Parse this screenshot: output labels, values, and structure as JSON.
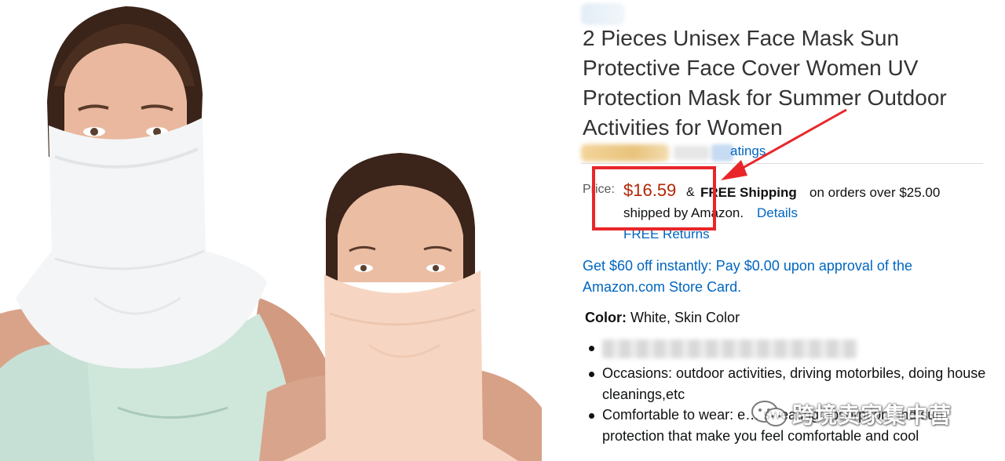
{
  "product": {
    "title": "2 Pieces Unisex Face Mask Sun Protective Face Cover Women UV Protection Mask for Summer Outdoor Activities for Women",
    "ratings_link_text": "atings",
    "image_description": "product-photo-face-masks"
  },
  "price_block": {
    "label": "Price:",
    "price": "$16.59",
    "ampersand": "&",
    "free_shipping": "FREE Shipping",
    "shipping_condition": "on orders over $25.00",
    "shipped_by": "shipped by Amazon.",
    "details_link": "Details",
    "free_returns": "FREE Returns"
  },
  "card_offer": "Get $60 off instantly: Pay $0.00 upon approval of the Amazon.com Store Card.",
  "color": {
    "label": "Color:",
    "value": "White, Skin Color"
  },
  "bullets": [
    {
      "text": ""
    },
    {
      "text": "Occasions: outdoor activities, driving motorbiles, doing house cleanings,etc"
    },
    {
      "text": "Comfortable to wear: e… sweating absorption and sun protection that make you feel comfortable and cool"
    }
  ],
  "watermark": {
    "text": "跨境卖家集中营",
    "icon": "wechat-icon"
  },
  "colors": {
    "price_red": "#B12704",
    "link_blue": "#0066C0",
    "highlight_red": "#E8262A",
    "mask_white": "#F4F5F6",
    "mask_skin": "#F6D6C2"
  }
}
